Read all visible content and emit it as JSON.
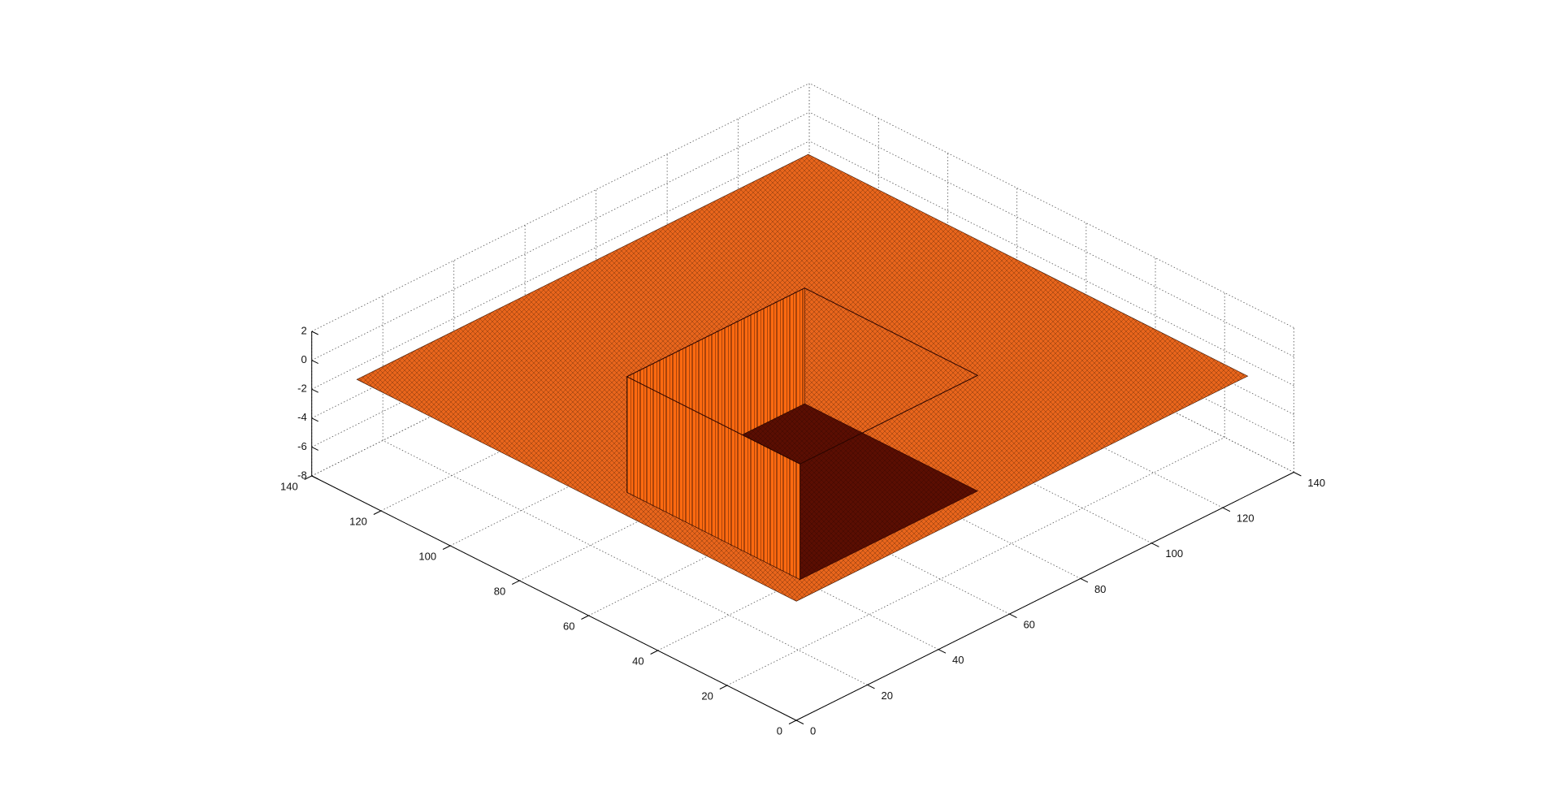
{
  "chart_data": {
    "type": "surface",
    "title": "",
    "xlabel": "",
    "ylabel": "",
    "zlabel": "",
    "xlim": [
      0,
      140
    ],
    "ylim": [
      0,
      140
    ],
    "zlim": [
      -8,
      2
    ],
    "x_ticks": [
      "0",
      "20",
      "40",
      "60",
      "80",
      "100",
      "120",
      "140"
    ],
    "y_ticks": [
      "0",
      "20",
      "40",
      "60",
      "80",
      "100",
      "120",
      "140"
    ],
    "z_ticks": [
      "-8",
      "-6",
      "-4",
      "-2",
      "0",
      "2"
    ],
    "grid": true,
    "outer_surface": {
      "x_range": [
        1,
        128
      ],
      "y_range": [
        1,
        128
      ],
      "z": 0
    },
    "inner_depression": {
      "x_range": [
        40,
        90
      ],
      "y_range": [
        40,
        90
      ],
      "z": -8
    },
    "colors": {
      "outer": "#e8651c",
      "walls": "#ff6a10",
      "floor": "#5a0e02",
      "mesh": "#3a1400",
      "grid": "#555555",
      "axes": "#000000"
    }
  }
}
